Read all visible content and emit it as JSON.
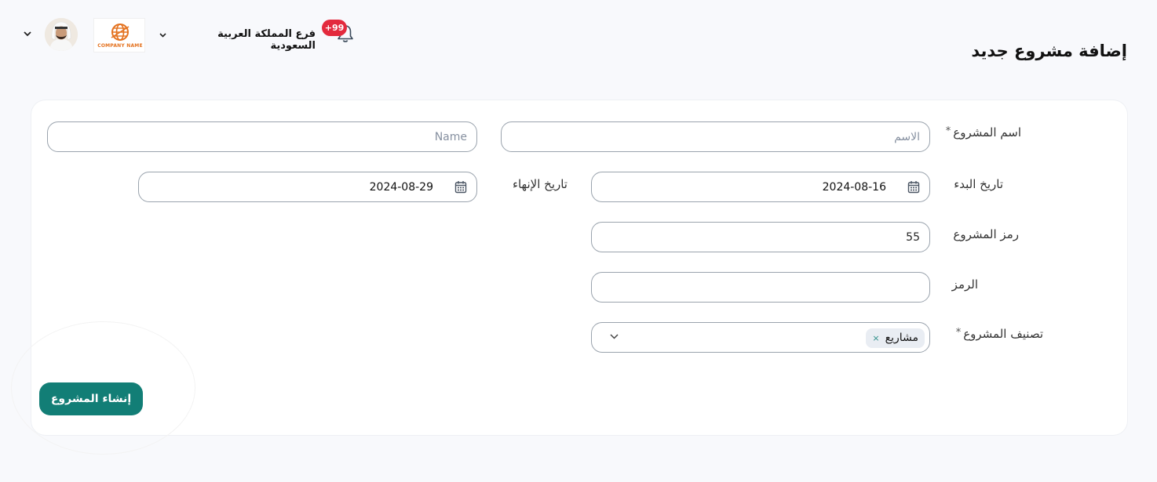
{
  "header": {
    "page_title": "إضافة مشروع جديد",
    "branch_name": "فرع المملكة العربية السعودية",
    "notifications_count": "+99",
    "company_logo_text": "COMPANY NAME",
    "colors": {
      "badge": "#e32a3d",
      "logo": "#e4721f"
    }
  },
  "form": {
    "project_name": {
      "label": "اسم المشروع",
      "required_mark": "*",
      "arabic_placeholder": "الاسم",
      "english_placeholder": "Name"
    },
    "start_date": {
      "label": "تاريخ البدء",
      "value": "2024-08-16"
    },
    "end_date": {
      "label": "تاريخ الإنهاء",
      "value": "2024-08-29"
    },
    "project_code": {
      "label": "رمز المشروع",
      "value": "55"
    },
    "code": {
      "label": "الرمز",
      "value": ""
    },
    "classification": {
      "label": "تصنيف المشروع",
      "required_mark": "*",
      "selected": "مشاريع",
      "remove_symbol": "×"
    },
    "submit_label": "إنشاء المشروع"
  },
  "colors": {
    "primary": "#127e76",
    "chip_bg": "#e9edf3",
    "border": "#9aa3ad"
  }
}
